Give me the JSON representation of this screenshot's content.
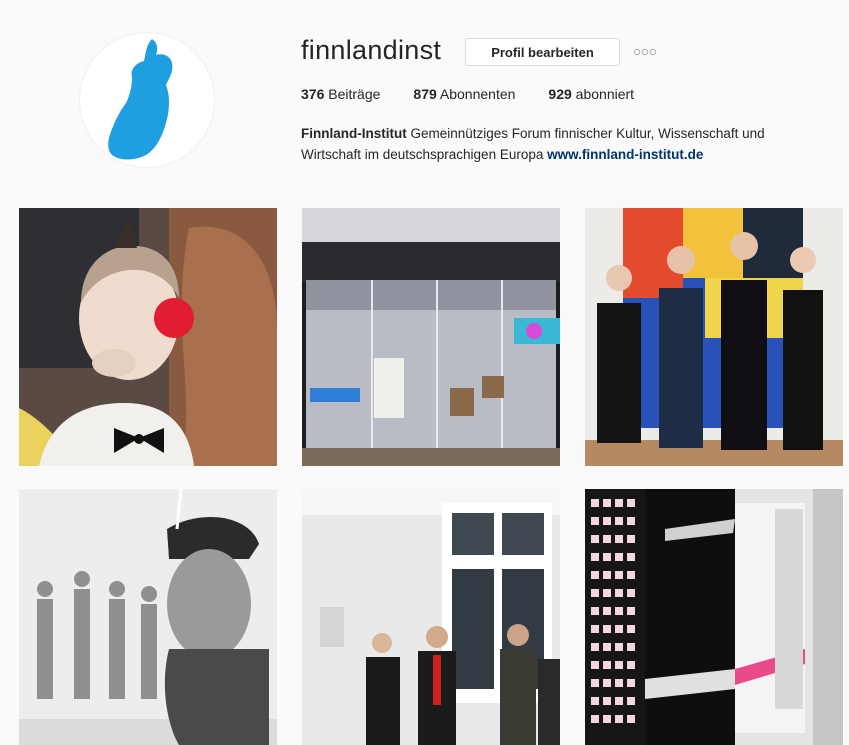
{
  "profile": {
    "username": "finnlandinst",
    "edit_button_label": "Profil bearbeiten",
    "more_options_icon": "ellipsis-icon",
    "avatar_icon": "finland-map-logo",
    "stats": {
      "posts_count": "376",
      "posts_label": "Beiträge",
      "followers_count": "879",
      "followers_label": "Abonnenten",
      "following_count": "929",
      "following_label": "abonniert"
    },
    "bio": {
      "name": "Finnland-Institut",
      "text": "Gemeinnütziges Forum finnischer Kultur, Wissenschaft und Wirtschaft im deutschsprachigen Europa",
      "website": "www.finnland-institut.de"
    }
  },
  "colors": {
    "link": "#003569",
    "accent_blue": "#1f9ee0",
    "background": "#fafafa",
    "border": "#dbdbdb"
  },
  "posts": [
    {
      "subject": "clown-portrait-photo"
    },
    {
      "subject": "mirrored-installation-photo"
    },
    {
      "subject": "group-in-front-of-painting-photo"
    },
    {
      "subject": "pencil-drawing-photo"
    },
    {
      "subject": "gallery-opening-photo"
    },
    {
      "subject": "abstract-painting-photo"
    }
  ]
}
